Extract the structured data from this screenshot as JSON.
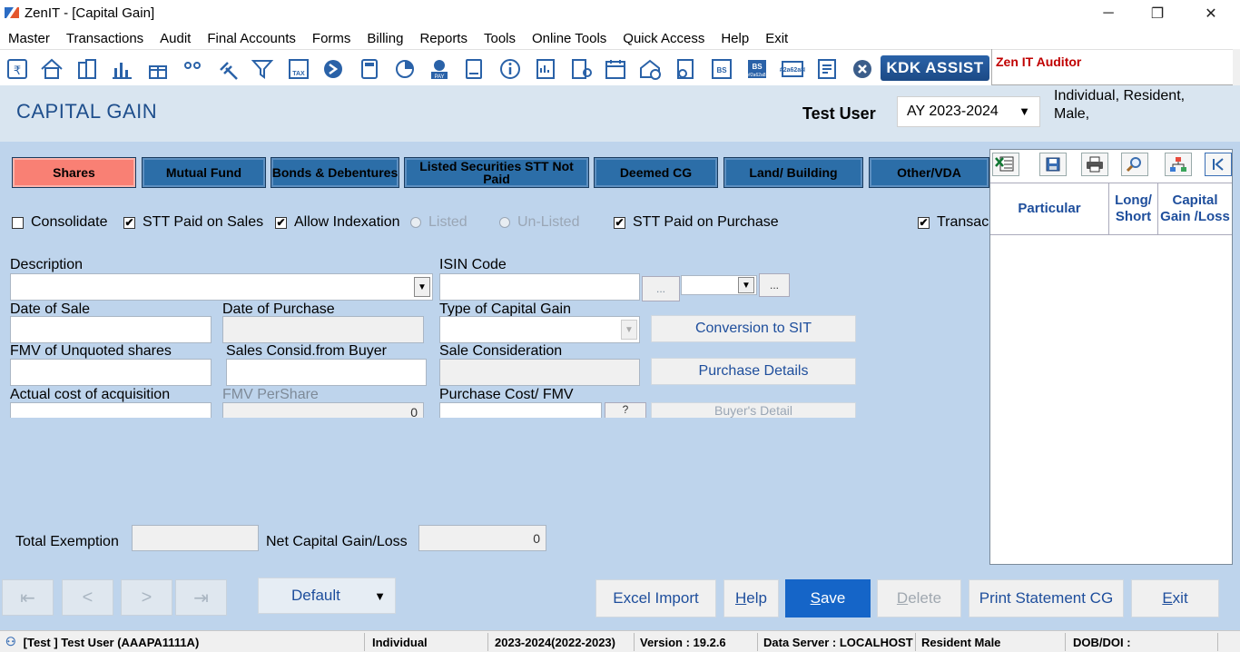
{
  "window": {
    "title": "ZenIT - [Capital Gain]",
    "controls": {
      "minimize": "─",
      "maximize": "❐",
      "close": "✕"
    }
  },
  "menu": [
    "Master",
    "Transactions",
    "Audit",
    "Final Accounts",
    "Forms",
    "Billing",
    "Reports",
    "Tools",
    "Online Tools",
    "Quick Access",
    "Help",
    "Exit"
  ],
  "toolbar": {
    "icons": [
      "rupee-doc-icon",
      "home-icon",
      "building-icon",
      "bar-chart-icon",
      "gift-icon",
      "people-icon",
      "gavel-icon",
      "filter-icon",
      "tax-icon",
      "arrow-circle-icon",
      "calculator-icon",
      "pie-chart-icon",
      "pay-icon",
      "book-icon",
      "info-icon",
      "report-icon",
      "user-doc-icon",
      "calendar-icon",
      "house-add-icon",
      "doc-circle-icon",
      "bs-icon",
      "bs-sch-icon",
      "3cd-icon",
      "form-icon",
      "close-circle-icon"
    ],
    "kdk_label": "KDK ASSIST",
    "auditor_label": "Zen IT Auditor"
  },
  "header": {
    "title": "CAPITAL GAIN",
    "user": "Test User",
    "assessment_year": "AY 2023-2024",
    "assessee_line1": "Individual, Resident,",
    "assessee_line2": "Male,"
  },
  "tabs": [
    {
      "label": "Shares",
      "active": true
    },
    {
      "label": "Mutual Fund"
    },
    {
      "label": "Bonds & Debentures"
    },
    {
      "label": "Listed Securities STT Not Paid"
    },
    {
      "label": "Deemed CG"
    },
    {
      "label": "Land/ Building"
    },
    {
      "label": "Other/VDA"
    }
  ],
  "options": {
    "consolidate": "Consolidate",
    "stt_sales": "STT Paid on Sales",
    "indexation": "Allow Indexation",
    "listed": "Listed",
    "unlisted": "Un-Listed",
    "stt_purchase": "STT Paid on Purchase",
    "transac": "Transac",
    "check_mark": "✔"
  },
  "form": {
    "description": "Description",
    "isin": "ISIN Code",
    "dots": "...",
    "date_sale": "Date of Sale",
    "date_purchase": "Date of Purchase",
    "type_cg": "Type of Capital Gain",
    "conversion": "Conversion to SIT",
    "fmv_unquoted": "FMV of Unquoted shares",
    "sales_consid_buyer": "Sales Consid.from Buyer",
    "sale_consideration": "Sale Consideration",
    "purchase_details": "Purchase Details",
    "actual_cost": "Actual cost of acquisition",
    "fmv_pershare": "FMV PerShare",
    "fmv_pershare_value": "0",
    "purchase_cost_fmv": "Purchase Cost/ FMV",
    "question": "?",
    "buyers_detail": "Buyer's Detail",
    "total_exemption": "Total Exemption",
    "net_cg": "Net Capital Gain/Loss",
    "net_cg_value": "0"
  },
  "right_panel": {
    "icons": [
      "excel-icon",
      "save-disk-icon",
      "print-icon",
      "search-icon",
      "hierarchy-icon",
      "collapse-left-icon"
    ],
    "columns": [
      "Particular",
      "Long/ Short",
      "Capital Gain /Loss"
    ]
  },
  "bottom": {
    "nav": {
      "first": "⇤",
      "prev": "<",
      "next": ">",
      "last": "⇥"
    },
    "default_label": "Default",
    "default_arrow": "▼",
    "excel_import": "Excel Import",
    "help": "Help",
    "save": "Save",
    "delete": "Delete",
    "print_statement": "Print Statement CG",
    "exit": "Exit"
  },
  "status": {
    "user": "[Test ] Test User (AAAPA1111A)",
    "type": "Individual",
    "year": "2023-2024(2022-2023)",
    "version": "Version : 19.2.6",
    "server": "Data Server : LOCALHOST",
    "residency": "Resident Male",
    "dob": "DOB/DOI :"
  }
}
